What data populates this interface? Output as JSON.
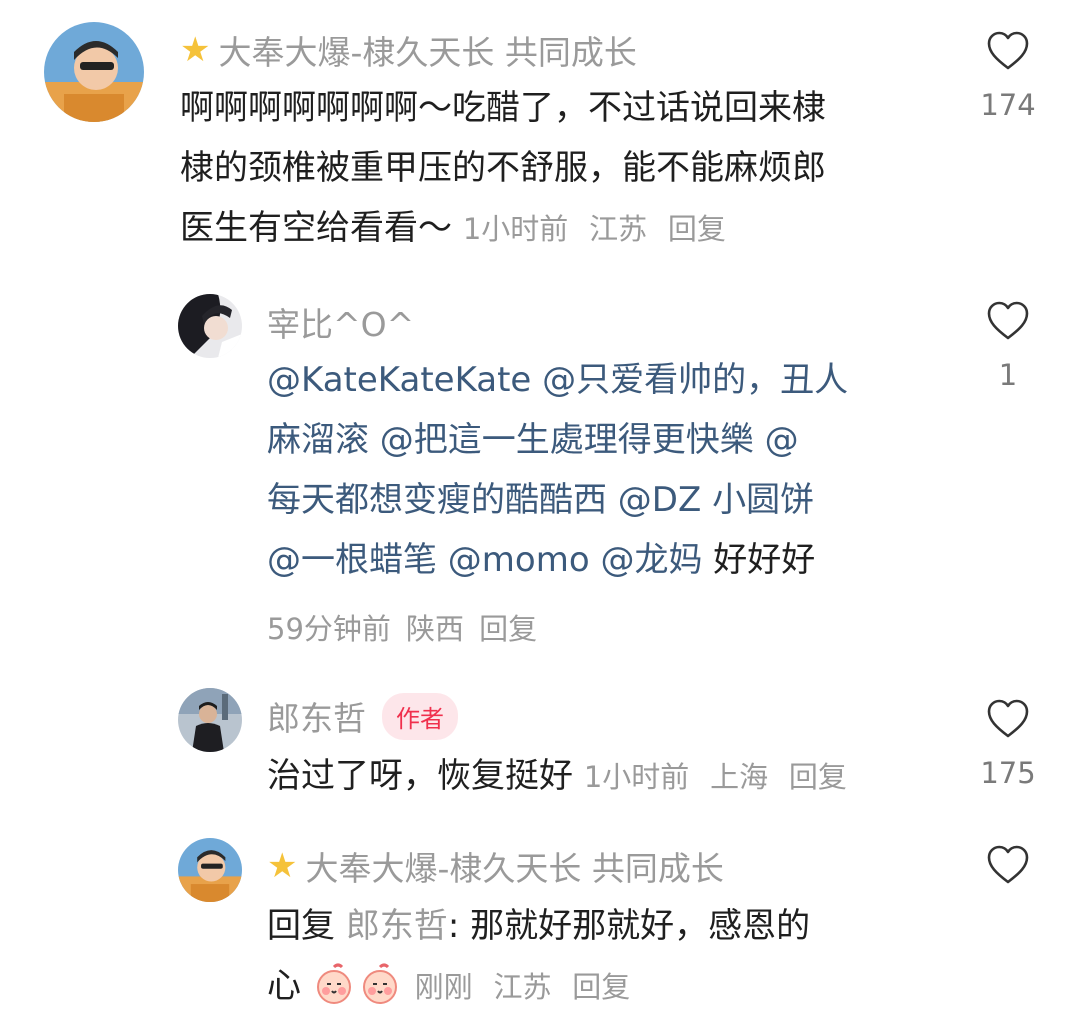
{
  "comments": [
    {
      "user": "大奉大爆-棣久天长 共同成长",
      "star_icon": "star-icon",
      "text": "啊啊啊啊啊啊啊～吃醋了，不过话说回来棣棣的颈椎被重甲压的不舒服，能不能麻烦郎医生有空给看看～",
      "lines": [
        "啊啊啊啊啊啊啊～吃醋了，不过话说回来棣",
        "棣的颈椎被重甲压的不舒服，能不能麻烦郎",
        "医生有空给看看～"
      ],
      "time": "1小时前",
      "location": "江苏",
      "reply_label": "回复",
      "likes": "174"
    },
    {
      "user": "宰比^O^",
      "mentions": [
        "@KateKateKate",
        "@只爱看帅的，丑人麻溜滚",
        "@把這一生處理得更快樂",
        "@每天都想变瘦的酷酷西",
        "@DZ 小圆饼",
        "@一根蜡笔",
        "@momo",
        "@龙妈"
      ],
      "lines": [
        [
          "@KateKateKate @只爱看帅的，丑人"
        ],
        [
          "麻溜滚 @把這一生處理得更快樂 @"
        ],
        [
          "每天都想变瘦的酷酷西 @DZ 小圆饼"
        ],
        [
          "@一根蜡笔 @momo @龙妈",
          " 好好好"
        ]
      ],
      "time": "59分钟前",
      "location": "陕西",
      "reply_label": "回复",
      "likes": "1"
    },
    {
      "user": "郎东哲",
      "badge": "作者",
      "text": "治过了呀，恢复挺好",
      "time": "1小时前",
      "location": "上海",
      "reply_label": "回复",
      "likes": "175"
    },
    {
      "user": "大奉大爆-棣久天长 共同成长",
      "star_icon": "star-icon",
      "reply_prefix": "回复",
      "reply_to": "郎东哲",
      "text_line1": ": 那就好那就好，感恩的",
      "text_line2": "心",
      "emojis": [
        "blush-emoji",
        "blush-emoji"
      ],
      "time": "刚刚",
      "location": "江苏",
      "reply_label": "回复",
      "likes": ""
    }
  ],
  "colors": {
    "secondary_text": "#9a9a9a",
    "mention": "#3c5a7c",
    "author_badge_bg": "#fde6ea",
    "author_badge_text": "#f0304d",
    "star": "#f5c23a"
  }
}
